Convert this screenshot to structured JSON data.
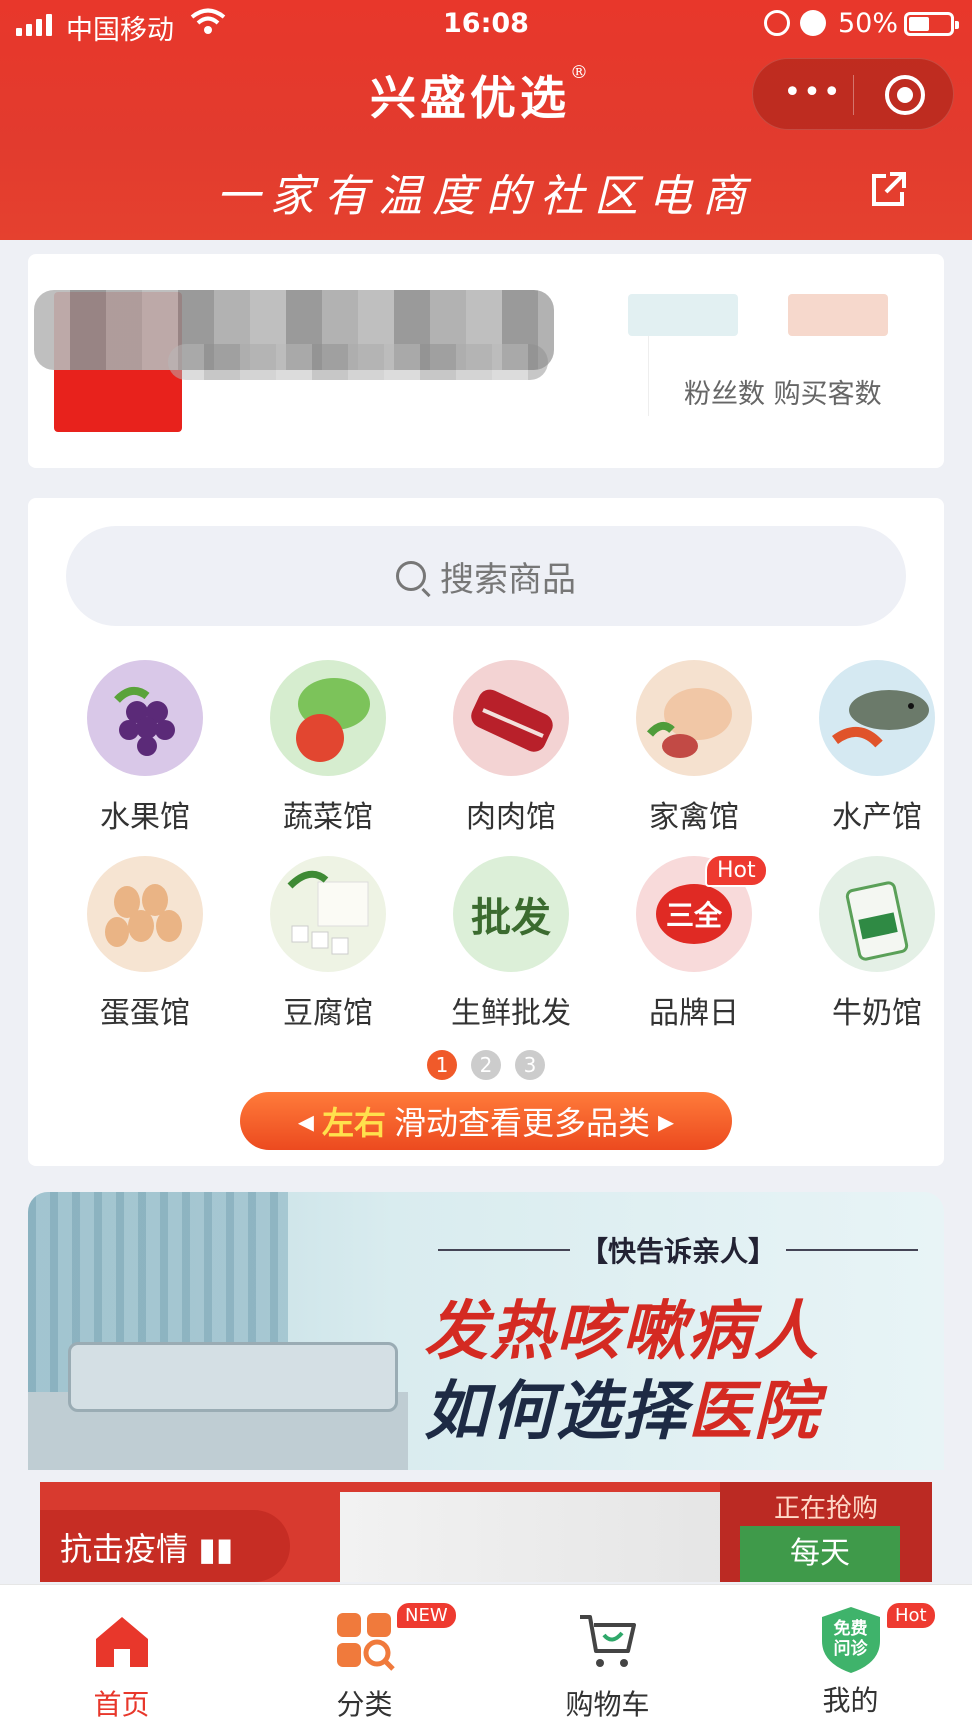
{
  "status_bar": {
    "carrier": "中国移动",
    "time": "16:08",
    "battery": "50%"
  },
  "header": {
    "brand": "兴盛优选",
    "registered_mark": "®",
    "slogan": "一家有温度的社区电商",
    "capsule_more": "•••"
  },
  "shop_card": {
    "stat_labels": "粉丝数  购买客数"
  },
  "search": {
    "placeholder": "搜索商品"
  },
  "categories": [
    {
      "label": "水果馆",
      "icon": "grapes-icon",
      "color": "#d9c8e8"
    },
    {
      "label": "蔬菜馆",
      "icon": "vegetables-icon",
      "color": "#d6edcf"
    },
    {
      "label": "肉肉馆",
      "icon": "meat-icon",
      "color": "#f3d3d3"
    },
    {
      "label": "家禽馆",
      "icon": "poultry-icon",
      "color": "#f5e1cf"
    },
    {
      "label": "水产馆",
      "icon": "fish-icon",
      "color": "#d5e9f2"
    },
    {
      "label": "蛋蛋馆",
      "icon": "eggs-icon",
      "color": "#f6e4d2"
    },
    {
      "label": "豆腐馆",
      "icon": "tofu-icon",
      "color": "#eef3e4"
    },
    {
      "label": "生鲜批发",
      "icon": "wholesale-icon",
      "color": "#dcefd8",
      "text": "批发"
    },
    {
      "label": "品牌日",
      "icon": "brand-day-icon",
      "color": "#f8dada",
      "text": "三全",
      "badge": "Hot"
    },
    {
      "label": "牛奶馆",
      "icon": "milk-icon",
      "color": "#e4f0e6"
    }
  ],
  "pager": [
    "1",
    "2",
    "3"
  ],
  "swipe_hint": {
    "highlight": "左右",
    "text": "滑动查看更多品类"
  },
  "banner": {
    "tag": "【快告诉亲人】",
    "line1": "发热咳嗽病人",
    "line2_a": "如何选择",
    "line2_b": "医院"
  },
  "banner2": {
    "left": "抗击疫情",
    "right_top": "正在抢购",
    "right_box": "每天"
  },
  "tabbar": [
    {
      "label": "首页",
      "active": true
    },
    {
      "label": "分类",
      "badge": "NEW"
    },
    {
      "label": "购物车"
    },
    {
      "label": "我的",
      "badge": "Hot",
      "shield_text": "免费问诊"
    }
  ],
  "colors": {
    "brand_red": "#e8372b",
    "accent_orange": "#f05a2a"
  }
}
